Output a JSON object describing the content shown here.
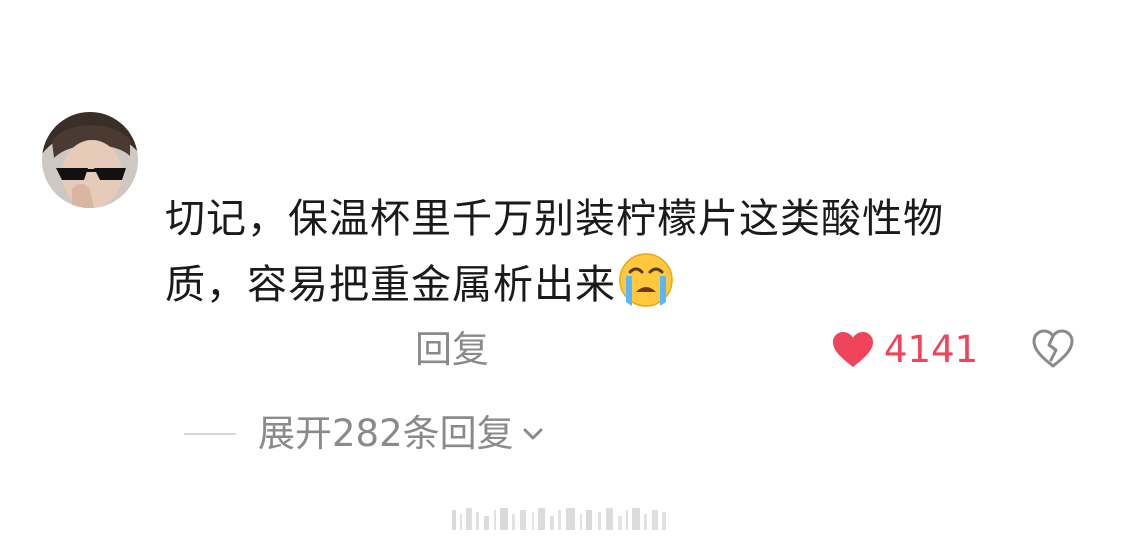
{
  "comment": {
    "text_line1": "切记，保温杯里千万别装柠檬片这类酸性物",
    "text_line2": "质，容易把重金属析出来",
    "emoji": "crying-face-emoji"
  },
  "actions": {
    "reply_label": "回复",
    "like_count": "4141",
    "like_icon": "heart-icon",
    "dislike_icon": "broken-heart-icon"
  },
  "replies": {
    "expand_label": "展开282条回复",
    "expand_icon": "chevron-down-icon"
  },
  "colors": {
    "like": "#f0445a",
    "secondary_text": "#8a8a8a",
    "primary_text": "#1a1a1a"
  }
}
